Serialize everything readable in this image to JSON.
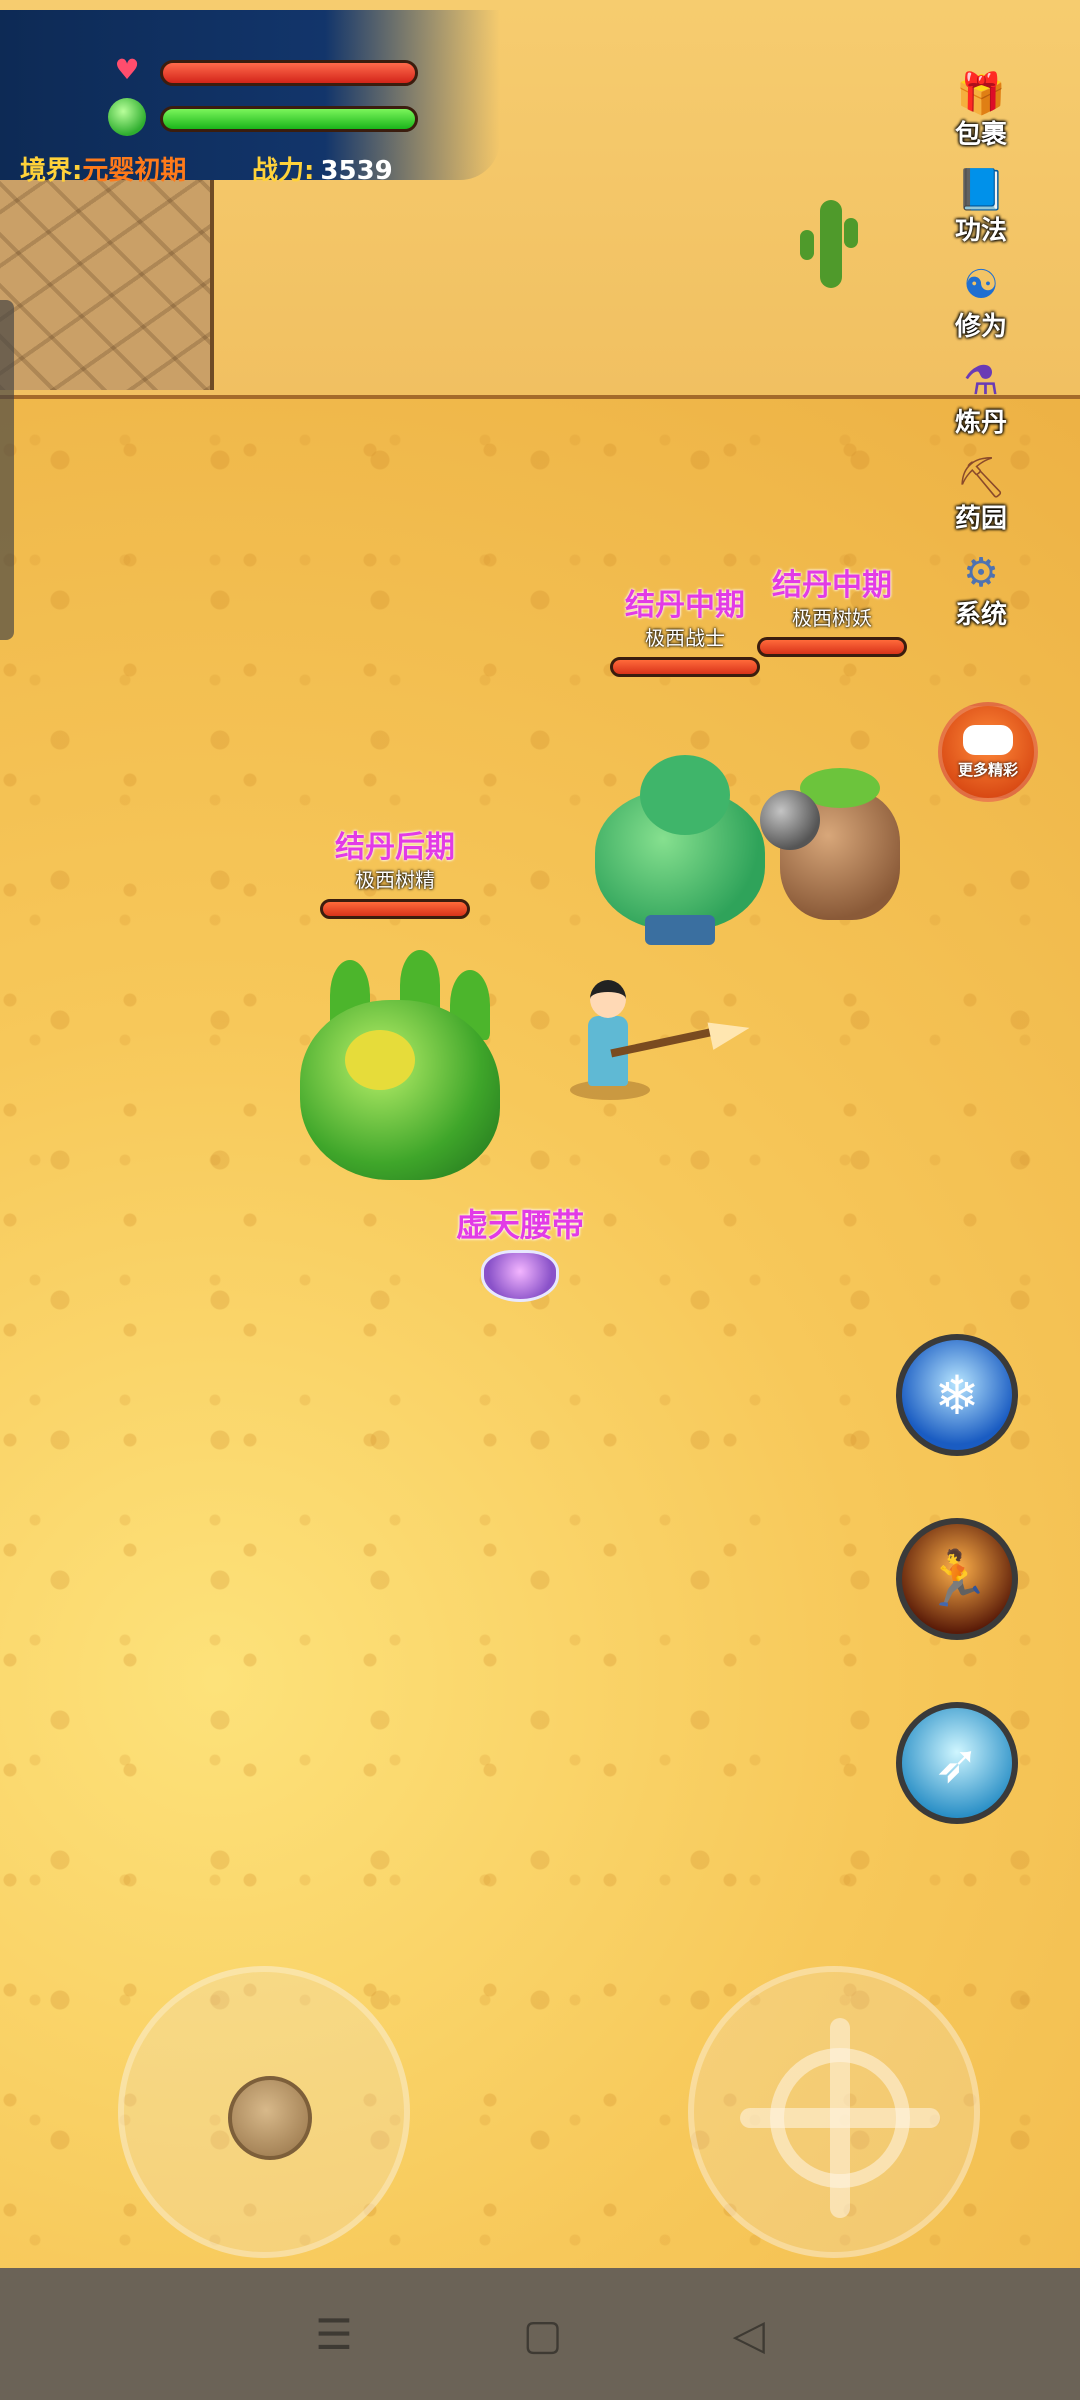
{
  "hud": {
    "realm_label": "境界:",
    "realm_value": "元婴初期",
    "power_label": "战力:",
    "power_value": "3539",
    "hp_fill": 1.0,
    "mp_fill": 1.0
  },
  "menu": [
    {
      "label": "包裹",
      "icon": "bag-icon",
      "glyph": "🎁"
    },
    {
      "label": "功法",
      "icon": "book-icon",
      "glyph": "📘"
    },
    {
      "label": "修为",
      "icon": "yin-yang-icon",
      "glyph": "☯"
    },
    {
      "label": "炼丹",
      "icon": "cauldron-icon",
      "glyph": "⚗"
    },
    {
      "label": "药园",
      "icon": "pickaxe-icon",
      "glyph": "⛏"
    },
    {
      "label": "系统",
      "icon": "gear-icon",
      "glyph": "⚙"
    }
  ],
  "more_label": "更多精彩",
  "monsters": [
    {
      "level": "结丹后期",
      "name": "极西树精"
    },
    {
      "level": "结丹中期",
      "name": "极西战士"
    },
    {
      "level": "结丹中期",
      "name": "极西树妖"
    }
  ],
  "loot": {
    "name": "虚天腰带"
  },
  "skills": [
    {
      "icon": "ice-crystal-icon",
      "glyph": "❄"
    },
    {
      "icon": "sprint-icon",
      "glyph": "🏃"
    },
    {
      "icon": "slash-icon",
      "glyph": "➶"
    }
  ],
  "nav": {
    "menu": "☰",
    "home": "▢",
    "back": "◁"
  },
  "colors": {
    "enemy_level": "#e23be6",
    "hp": "#d3251a",
    "mp": "#1ab51a",
    "gold_text": "#ffd23a"
  }
}
